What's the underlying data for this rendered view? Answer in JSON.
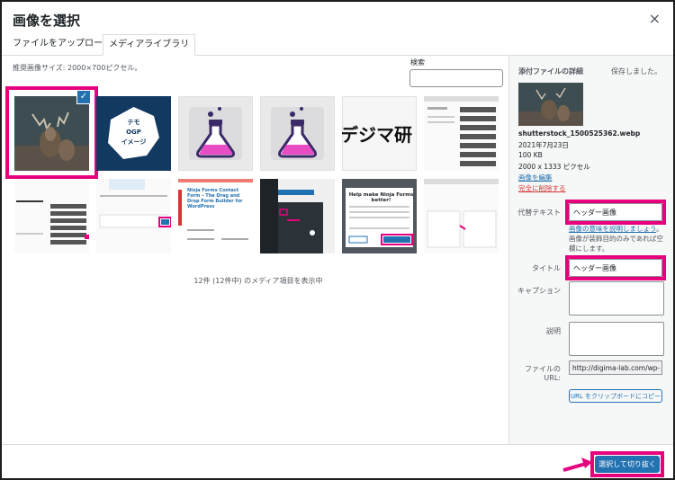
{
  "dialog": {
    "title": "画像を選択",
    "close_label": "×"
  },
  "tabs": [
    {
      "label": "ファイルをアップロード",
      "active": false
    },
    {
      "label": "メディアライブラリ",
      "active": true
    }
  ],
  "library": {
    "recommended_size": "推奨画像サイズ: 2000×700ピクセル。",
    "search_label": "検索",
    "search_placeholder": "",
    "count_text": "12件 (12件中) のメディア項目を表示中",
    "items": [
      {
        "name": "deer-photo",
        "selected": true
      },
      {
        "name": "ogp-image",
        "text": "テモ OGP イメージ"
      },
      {
        "name": "flask-icon-1"
      },
      {
        "name": "flask-icon-2"
      },
      {
        "name": "digima-logo",
        "text": "デジマ研"
      },
      {
        "name": "screenshot-admin-1"
      },
      {
        "name": "screenshot-menu"
      },
      {
        "name": "screenshot-settings"
      },
      {
        "name": "screenshot-ninja-forms",
        "text": "Ninja Forms Contact Form – The Drag and Drop Form Builder for WordPress"
      },
      {
        "name": "screenshot-dark-menu"
      },
      {
        "name": "screenshot-help-ninja",
        "text": "Help make Ninja Forms better!"
      },
      {
        "name": "screenshot-admin-2"
      }
    ]
  },
  "details": {
    "heading": "添付ファイルの詳細",
    "saved": "保存しました。",
    "filename": "shutterstock_1500525362.webp",
    "date": "2021年7月23日",
    "size": "100 KB",
    "dimensions": "2000 x 1333 ピクセル",
    "edit_link": "画像を編集",
    "delete_link": "完全に削除する",
    "alt_label": "代替テキスト",
    "alt_value": "ヘッダー画像",
    "alt_help_link": "画像の意味を説明しましょう",
    "alt_help_text": "。画像が装飾目的のみであれば空欄にします。",
    "title_label": "タイトル",
    "title_value": "ヘッダー画像",
    "caption_label": "キャプション",
    "caption_value": "",
    "description_label": "説明",
    "description_value": "",
    "url_label": "ファイルの URL:",
    "url_value": "http://digima-lab.com/wp-",
    "copy_button": "URL をクリップボードにコピー"
  },
  "footer": {
    "select_button": "選択して切り抜く"
  },
  "colors": {
    "accent": "#2271b1",
    "highlight": "#e6007e",
    "danger": "#d63638"
  }
}
